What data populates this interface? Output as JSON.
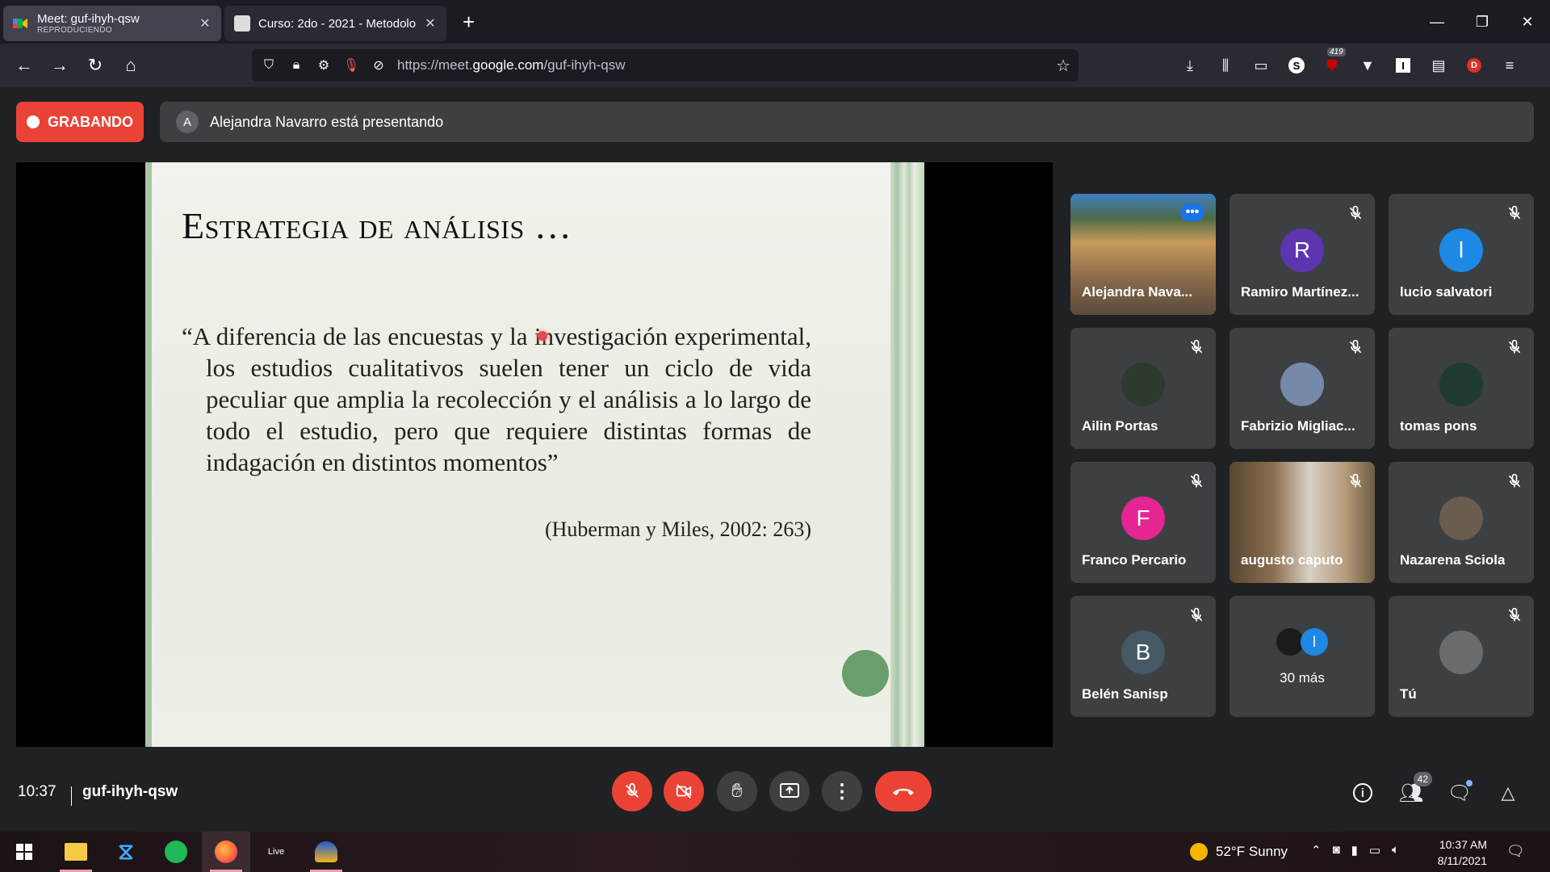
{
  "browser": {
    "tabs": [
      {
        "title": "Meet: guf-ihyh-qsw",
        "subtitle": "REPRODUCIENDO",
        "active": true
      },
      {
        "title": "Curso: 2do - 2021 - Metodolog",
        "subtitle": "",
        "active": false
      }
    ],
    "new_tab_icon": "plus-icon",
    "url_prefix": "https://meet.",
    "url_domain": "google.com",
    "url_path": "/guf-ihyh-qsw",
    "extension_badge": "419"
  },
  "meet": {
    "recording_label": "GRABANDO",
    "presenter_initial": "A",
    "presenting_text": "Alejandra Navarro está presentando",
    "slide": {
      "title": "Estrategia de análisis …",
      "quote": "“A diferencia de las encuestas y la investigación experimental, los estudios cualitativos suelen tener un ciclo de vida peculiar que amplia la recolección y el análisis a lo largo de todo el estudio, pero que requiere distintas formas de indagación en distintos momentos”",
      "citation": "(Huberman y Miles, 2002: 263)"
    },
    "participants": [
      {
        "name": "Alejandra Nava...",
        "type": "video",
        "initial": ""
      },
      {
        "name": "Ramiro Martínez...",
        "type": "letter",
        "initial": "R",
        "color": "#5e35b1"
      },
      {
        "name": "lucio salvatori",
        "type": "letter",
        "initial": "l",
        "color": "#1e88e5"
      },
      {
        "name": "Ailin Portas",
        "type": "photo",
        "initial": ""
      },
      {
        "name": "Fabrizio Migliac...",
        "type": "photo",
        "initial": ""
      },
      {
        "name": "tomas pons",
        "type": "photo",
        "initial": ""
      },
      {
        "name": "Franco Percario",
        "type": "letter",
        "initial": "F",
        "color": "#e52592"
      },
      {
        "name": "augusto caputo",
        "type": "video",
        "initial": ""
      },
      {
        "name": "Nazarena Sciola",
        "type": "photo",
        "initial": ""
      },
      {
        "name": "Belén Sanisp",
        "type": "letter",
        "initial": "B",
        "color": "#455a64"
      },
      {
        "name": "30 más",
        "type": "more",
        "initial": "l"
      },
      {
        "name": "Tú",
        "type": "photo",
        "initial": ""
      }
    ],
    "time": "10:37",
    "meeting_code": "guf-ihyh-qsw",
    "people_count": "42"
  },
  "taskbar": {
    "live_label": "Live",
    "weather": "52°F  Sunny",
    "clock_time": "10:37 AM",
    "clock_date": "8/11/2021"
  },
  "colors": {
    "meet_bg": "#202124",
    "tile_bg": "#3c4043",
    "danger": "#ea4335",
    "accent": "#8ab4f8"
  }
}
